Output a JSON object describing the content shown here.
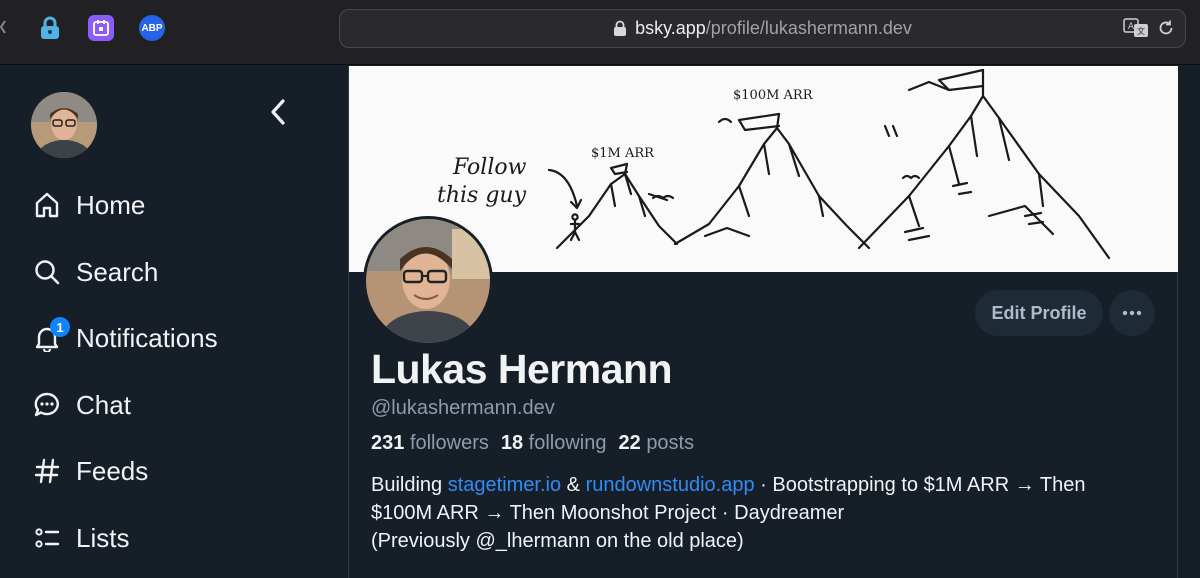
{
  "browser": {
    "url_host": "bsky.app",
    "url_path": "/profile/lukashermann.dev",
    "extensions": [
      {
        "name": "lock-extension",
        "icon": "padlock-icon"
      },
      {
        "name": "calendar-extension",
        "icon": "calendar-icon"
      },
      {
        "name": "adblock-extension",
        "label": "ABP"
      }
    ]
  },
  "sidebar": {
    "items": [
      {
        "label": "Home",
        "icon": "home-icon"
      },
      {
        "label": "Search",
        "icon": "search-icon"
      },
      {
        "label": "Notifications",
        "icon": "bell-icon",
        "badge": "1"
      },
      {
        "label": "Chat",
        "icon": "chat-icon"
      },
      {
        "label": "Feeds",
        "icon": "hash-icon"
      },
      {
        "label": "Lists",
        "icon": "list-icon"
      }
    ]
  },
  "banner": {
    "follow_text_1": "Follow",
    "follow_text_2": "this guy",
    "peak_small": "$1M ARR",
    "peak_large": "$100M ARR"
  },
  "profile": {
    "name": "Lukas Hermann",
    "handle": "@lukashermann.dev",
    "followers_count": "231",
    "followers_label": "followers",
    "following_count": "18",
    "following_label": "following",
    "posts_count": "22",
    "posts_label": "posts",
    "edit_label": "Edit Profile",
    "bio": {
      "prefix": "Building ",
      "link1": "stagetimer.io",
      "amp": " & ",
      "link2": "rundownstudio.app",
      "rest_line1": " · Bootstrapping to $1M ARR → Then",
      "line2": "$100M ARR → Then Moonshot Project · Daydreamer",
      "line3": "(Previously @_lhermann on the old place)"
    }
  },
  "colors": {
    "background": "#161e27",
    "accent": "#1083fe",
    "link": "#2f8cf6",
    "muted": "#8d9bab"
  }
}
